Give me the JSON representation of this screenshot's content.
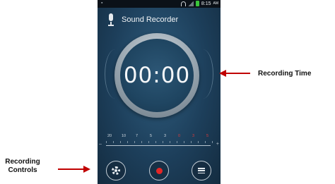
{
  "statusbar": {
    "left_indicator": "▪",
    "time": "8:15",
    "ampm": "AM",
    "battery_color": "#39c53a"
  },
  "app": {
    "title": "Sound Recorder",
    "icon": "microphone-icon"
  },
  "dial": {
    "timer_text": "00:00"
  },
  "meter": {
    "labels": [
      "20",
      "10",
      "7",
      "5",
      "3",
      "0",
      "3",
      "5"
    ],
    "red_from_index": 5,
    "minus": "–",
    "plus": "+"
  },
  "controls": {
    "settings_icon": "gear-icon",
    "record_icon": "record-icon",
    "menu_icon": "menu-icon",
    "record_color": "#e52626"
  },
  "annotations": {
    "time_label": "Recording Time",
    "controls_label_line1": "Recording",
    "controls_label_line2": "Controls",
    "arrow_color": "#c00000"
  }
}
